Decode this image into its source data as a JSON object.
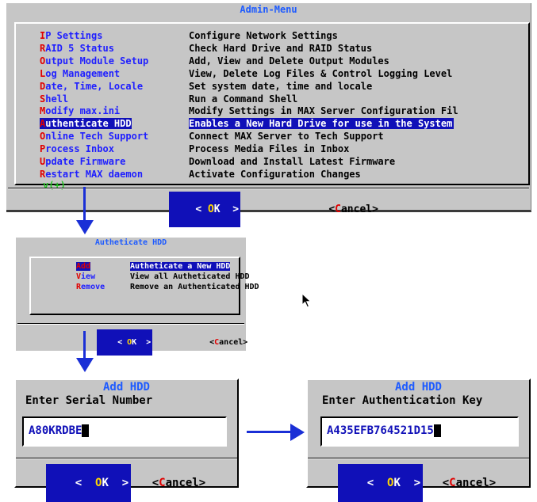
{
  "admin_menu": {
    "title": "Admin-Menu",
    "items": [
      {
        "hotkey": "I",
        "rest": "P Settings",
        "description": "Configure Network Settings"
      },
      {
        "hotkey": "R",
        "rest": "AID 5 Status",
        "description": "Check Hard Drive and RAID Status"
      },
      {
        "hotkey": "O",
        "rest": "utput Module Setup",
        "description": "Add, View and Delete Output Modules"
      },
      {
        "hotkey": "L",
        "rest": "og Management",
        "description": "View, Delete Log Files & Control Logging Level"
      },
      {
        "hotkey": "D",
        "rest": "ate, Time, Locale",
        "description": "Set system date, time and locale"
      },
      {
        "hotkey": "S",
        "rest": "hell",
        "description": "Run a Command Shell"
      },
      {
        "hotkey": "M",
        "rest": "odify max.ini",
        "description": "Modify Settings in MAX Server Configuration Fil"
      },
      {
        "hotkey": "A",
        "rest": "uthenticate HDD",
        "description": "Enables a New Hard Drive for use in the System",
        "selected": true
      },
      {
        "hotkey": "O",
        "rest": "nline Tech Support",
        "description": "Connect MAX Server to Tech Support"
      },
      {
        "hotkey": "P",
        "rest": "rocess Inbox",
        "description": "Process Media Files in Inbox"
      },
      {
        "hotkey": "U",
        "rest": "pdate Firmware",
        "description": "Download and Install Latest Firmware"
      },
      {
        "hotkey": "R",
        "rest": "estart MAX daemon",
        "description": "Activate Configuration Changes"
      }
    ],
    "scroll_indicator": "v(+)",
    "ok_label": {
      "pre": "< ",
      "hot": "O",
      "post": "K  >"
    },
    "cancel_label": {
      "pre": "<",
      "hot": "C",
      "post": "ancel>"
    }
  },
  "auth_menu": {
    "title": "Autheticate HDD",
    "items": [
      {
        "pre": "",
        "hotkey": "A",
        "rest": "dd",
        "description": "Autheticate a New HDD",
        "selected": true
      },
      {
        "pre": "",
        "hotkey": "V",
        "rest": "iew",
        "description": "View all Autheticated HDD"
      },
      {
        "pre": "",
        "hotkey": "R",
        "rest": "emove",
        "description": "Remove an Authenticated HDD"
      }
    ],
    "ok_label": {
      "pre": "< ",
      "hot": "O",
      "post": "K  >"
    },
    "cancel_label": {
      "pre": "<",
      "hot": "C",
      "post": "ancel>"
    }
  },
  "add_serial": {
    "title": "Add HDD",
    "prompt": "Enter Serial Number",
    "value": "A80KRDBE",
    "ok_label": {
      "pre": "<  ",
      "hot": "O",
      "post": "K  >"
    },
    "cancel_label": {
      "pre": "<",
      "hot": "C",
      "post": "ancel>"
    }
  },
  "add_key": {
    "title": "Add HDD",
    "prompt": "Enter Authentication Key",
    "value": "A435EFB764521D15",
    "ok_label": {
      "pre": "<  ",
      "hot": "O",
      "post": "K  >"
    },
    "cancel_label": {
      "pre": "<",
      "hot": "C",
      "post": "ancel>"
    }
  },
  "colors": {
    "accent": "#1010b8",
    "hotkey": "#e00000",
    "title": "#1e5bff",
    "arrow": "#1a2fd6"
  }
}
